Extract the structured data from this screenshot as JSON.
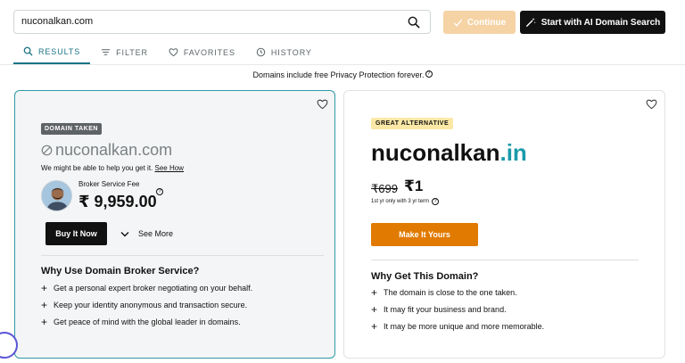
{
  "search": {
    "value": "nuconalkan.com"
  },
  "header": {
    "continue_label": "Continue",
    "ai_search_label": "Start with AI Domain Search"
  },
  "tabs": [
    {
      "label": "RESULTS",
      "icon": "search-icon",
      "active": true
    },
    {
      "label": "FILTER",
      "icon": "filter-icon",
      "active": false
    },
    {
      "label": "FAVORITES",
      "icon": "heart-icon",
      "active": false
    },
    {
      "label": "HISTORY",
      "icon": "history-icon",
      "active": false
    }
  ],
  "privacy_note": "Domains include free Privacy Protection forever.",
  "taken_card": {
    "badge": "DOMAIN TAKEN",
    "domain": "nuconalkan.com",
    "help_text": "We might be able to help you get it.",
    "help_link": "See How",
    "broker_label": "Broker Service Fee",
    "broker_price": "₹ 9,959.00",
    "buy_label": "Buy It Now",
    "see_more_label": "See More",
    "why_title": "Why Use Domain Broker Service?",
    "reasons": [
      "Get a personal expert broker negotiating on your behalf.",
      "Keep your identity anonymous and transaction secure.",
      "Get peace of mind with the global leader in domains."
    ]
  },
  "alt_card": {
    "badge": "GREAT ALTERNATIVE",
    "domain_name": "nuconalkan",
    "domain_tld": ".in",
    "old_price": "₹699",
    "new_price": "₹1",
    "term": "1st yr only with 3 yr term",
    "cta_label": "Make It Yours",
    "why_title": "Why Get This Domain?",
    "reasons": [
      "The domain is close to the one taken.",
      "It may fit your business and brand.",
      "It may be more unique and more memorable."
    ]
  },
  "colors": {
    "accent_teal": "#1a7486",
    "tld_teal": "#1a9aaa",
    "cta_orange": "#e17a00",
    "continue_disabled": "#f6d3a5",
    "alt_badge_bg": "#fbe8a6"
  }
}
